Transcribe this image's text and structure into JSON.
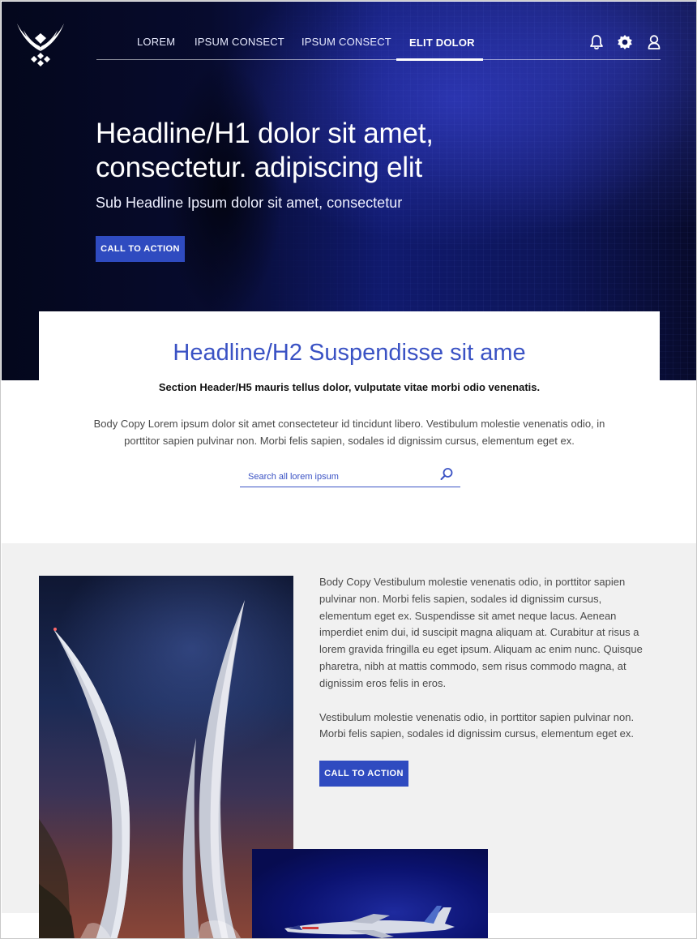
{
  "nav": {
    "items": [
      {
        "label": "LOREM"
      },
      {
        "label": "IPSUM CONSECT"
      },
      {
        "label": "IPSUM CONSECT"
      },
      {
        "label": "ELIT DOLOR",
        "active": true
      }
    ],
    "icons": [
      "bell-icon",
      "gear-icon",
      "user-icon"
    ]
  },
  "hero": {
    "headline": "Headline/H1 dolor sit amet, consectetur. adipiscing elit",
    "subheadline": "Sub Headline Ipsum dolor sit amet, consectetur",
    "cta_label": "CALL TO ACTION"
  },
  "intro": {
    "headline": "Headline/H2 Suspendisse sit ame",
    "section_header": "Section Header/H5 mauris tellus dolor, vulputate vitae morbi odio venenatis.",
    "body": "Body Copy Lorem ipsum dolor sit amet consecteteur id tincidunt libero. Vestibulum molestie venenatis odio, in porttitor sapien pulvinar non. Morbi felis sapien, sodales id dignissim cursus, elementum eget ex.",
    "search_placeholder": "Search all lorem ipsum"
  },
  "feature": {
    "paragraph1": "Body Copy Vestibulum molestie venenatis odio, in porttitor sapien pulvinar non. Morbi felis sapien, sodales id dignissim cursus, elementum eget ex. Suspendisse sit amet neque lacus. Aenean imperdiet enim dui, id suscipit magna aliquam at. Curabitur at risus a lorem gravida fringilla eu eget ipsum. Aliquam ac enim nunc. Quisque pharetra, nibh at mattis commodo, sem risus commodo magna, at dignissim eros felis in eros.",
    "paragraph2": "Vestibulum molestie venenatis odio, in porttitor sapien pulvinar non. Morbi felis sapien, sodales id dignissim cursus, elementum eget ex.",
    "cta_label": "CALL TO ACTION"
  },
  "colors": {
    "accent": "#2f4bc0",
    "headline_blue": "#3a52c4",
    "hero_dark": "#070b2e",
    "section_grey": "#f1f1f1"
  }
}
